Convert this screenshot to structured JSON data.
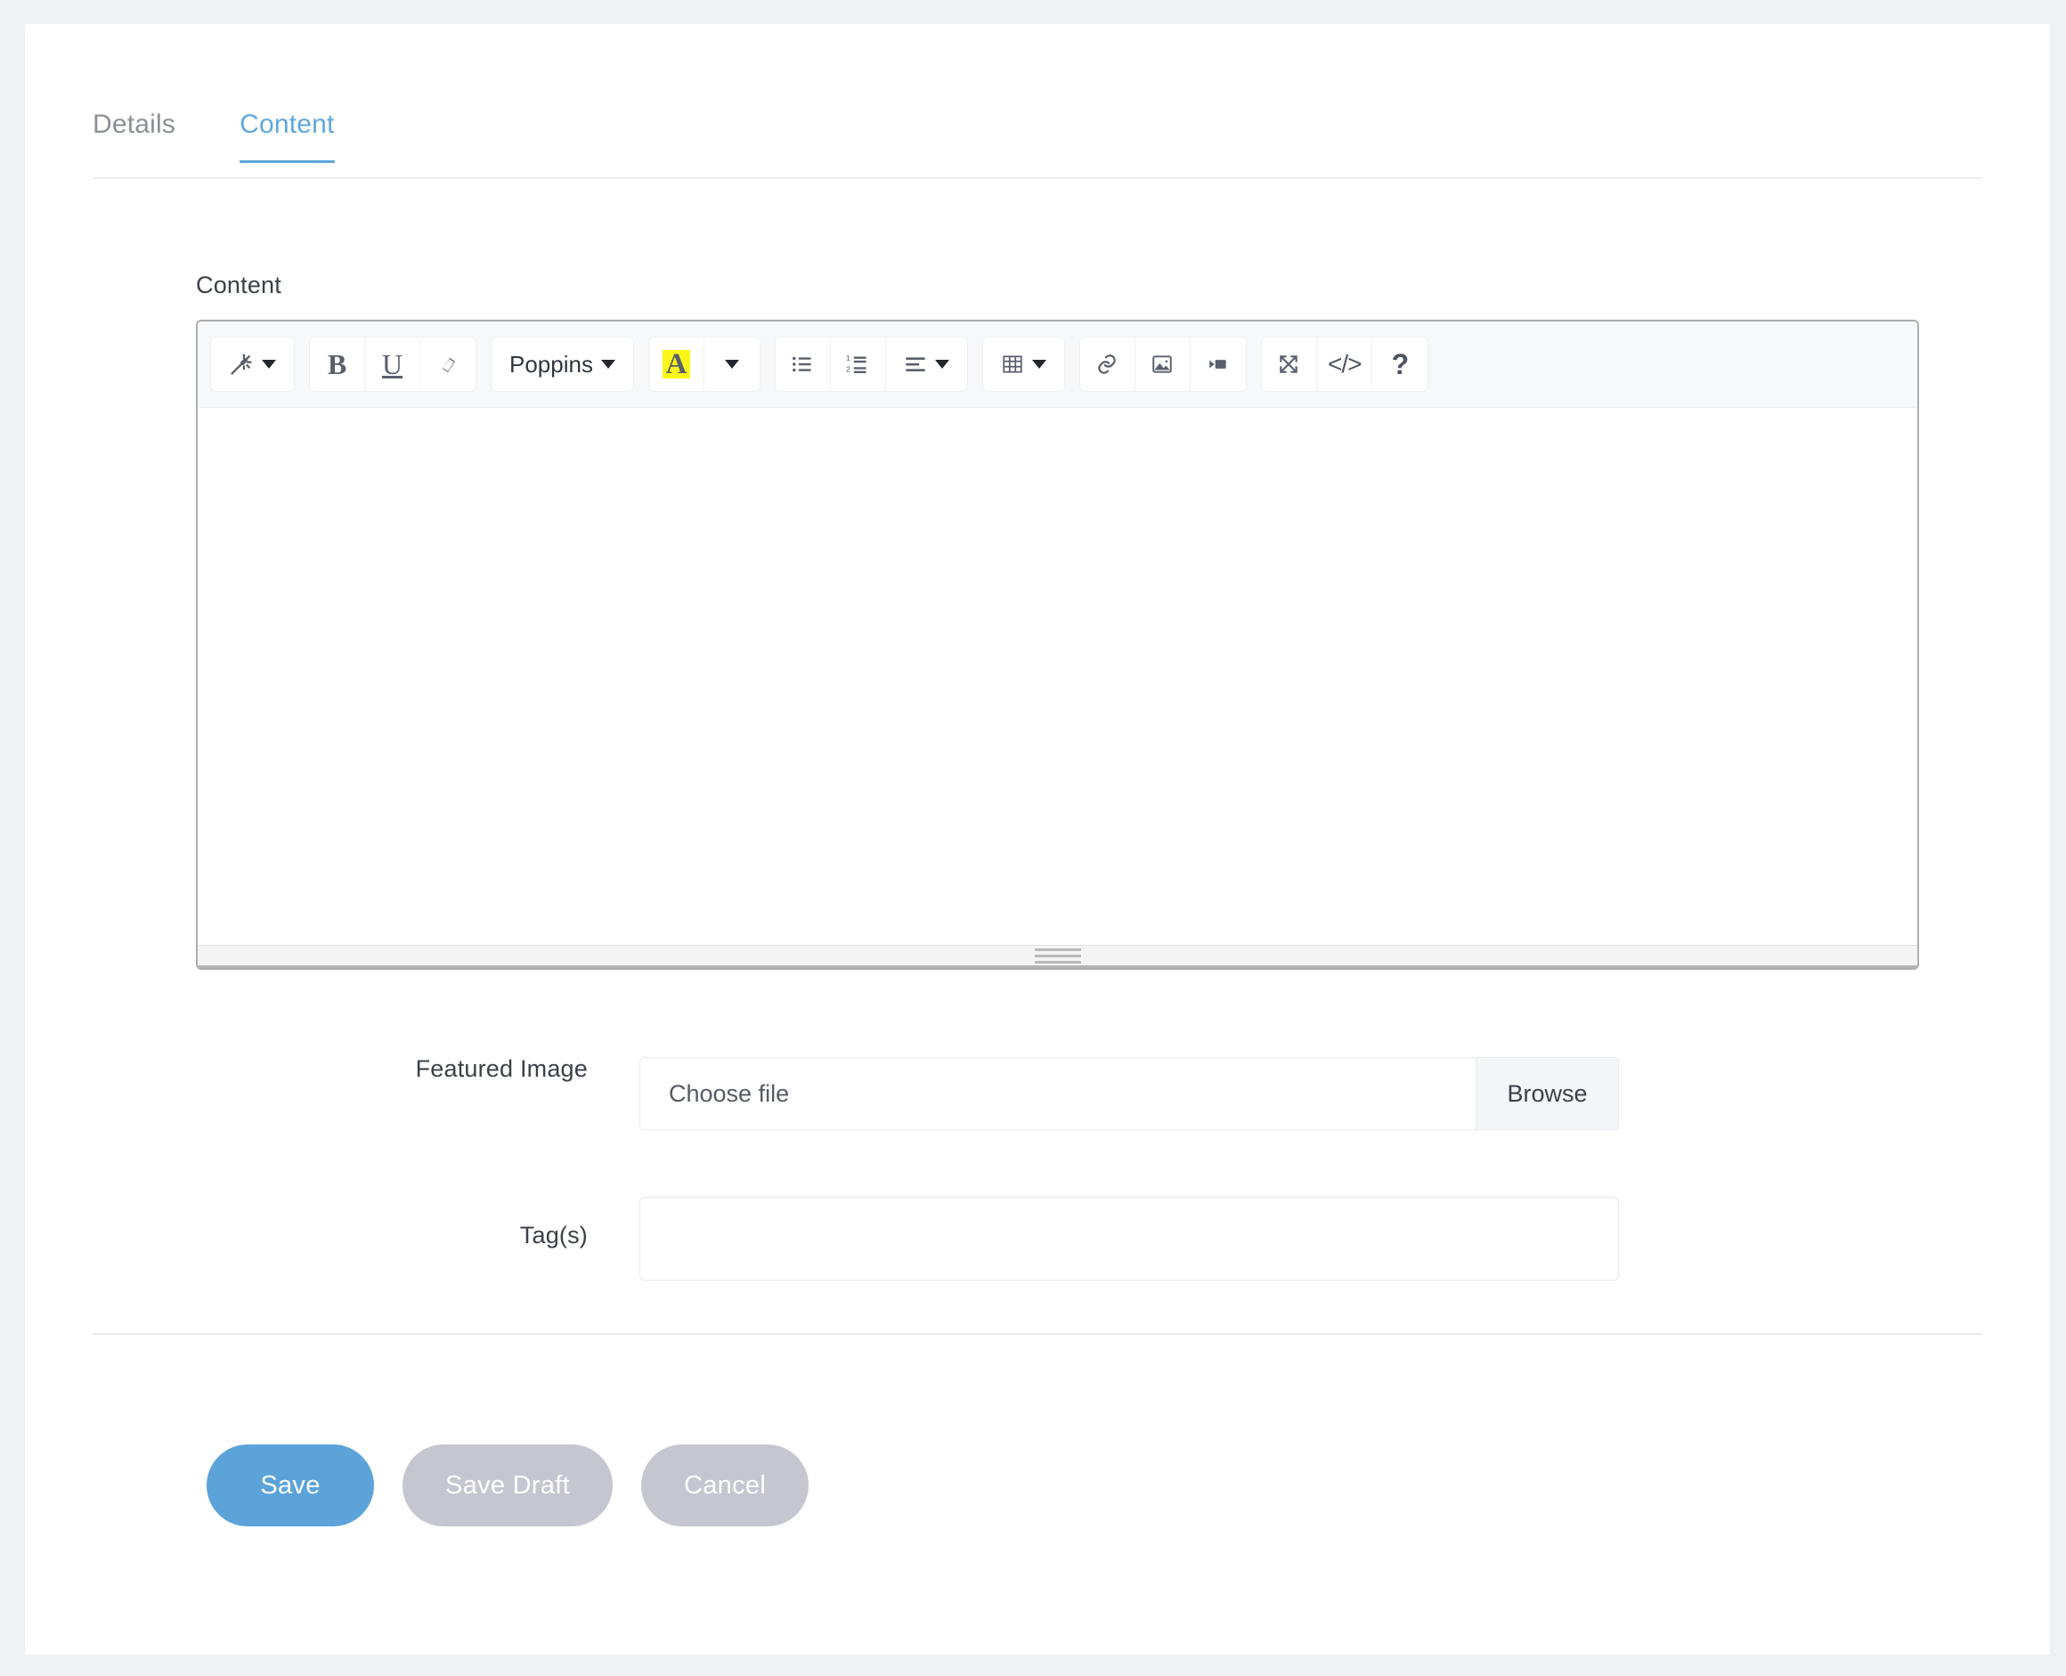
{
  "tabs": [
    {
      "label": "Details",
      "active": false
    },
    {
      "label": "Content",
      "active": true
    }
  ],
  "editor_section": {
    "label": "Content",
    "body_text": "",
    "toolbar": {
      "groups": [
        {
          "name": "magic",
          "buttons": [
            {
              "icon": "magic-wand-icon",
              "label": "",
              "has_caret": true
            }
          ]
        },
        {
          "name": "text-style",
          "buttons": [
            {
              "icon": "bold-icon",
              "label": "B",
              "has_caret": false
            },
            {
              "icon": "underline-icon",
              "label": "U",
              "has_caret": false
            },
            {
              "icon": "eraser-icon",
              "label": "",
              "has_caret": false
            }
          ]
        },
        {
          "name": "font-family",
          "buttons": [
            {
              "icon": "font-family-icon",
              "label": "Poppins",
              "has_caret": true
            }
          ]
        },
        {
          "name": "text-color",
          "buttons": [
            {
              "icon": "text-highlight-icon",
              "label": "A",
              "has_caret": false
            },
            {
              "icon": "color-picker-icon",
              "label": "",
              "has_caret": true
            }
          ]
        },
        {
          "name": "lists",
          "buttons": [
            {
              "icon": "unordered-list-icon",
              "label": "",
              "has_caret": false
            },
            {
              "icon": "ordered-list-icon",
              "label": "",
              "has_caret": false
            },
            {
              "icon": "align-icon",
              "label": "",
              "has_caret": true
            }
          ]
        },
        {
          "name": "table",
          "buttons": [
            {
              "icon": "table-icon",
              "label": "",
              "has_caret": true
            }
          ]
        },
        {
          "name": "insert",
          "buttons": [
            {
              "icon": "link-icon",
              "label": "",
              "has_caret": false
            },
            {
              "icon": "image-icon",
              "label": "",
              "has_caret": false
            },
            {
              "icon": "video-icon",
              "label": "",
              "has_caret": false
            }
          ]
        },
        {
          "name": "misc",
          "buttons": [
            {
              "icon": "fullscreen-icon",
              "label": "",
              "has_caret": false
            },
            {
              "icon": "code-view-icon",
              "label": "</>",
              "has_caret": false
            },
            {
              "icon": "help-icon",
              "label": "?",
              "has_caret": false
            }
          ]
        }
      ]
    },
    "resize_handle": "resize-grip"
  },
  "fields": {
    "featured_image": {
      "label": "Featured Image",
      "value": "",
      "placeholder": "Choose file",
      "browse_label": "Browse"
    },
    "tags": {
      "label": "Tag(s)",
      "value": "",
      "placeholder": ""
    }
  },
  "actions": {
    "save": "Save",
    "save_draft": "Save Draft",
    "cancel": "Cancel"
  },
  "colors": {
    "accent": "#5ba3d9",
    "muted_button": "#c5c6d0",
    "page_background": "#eef0f4",
    "card_background": "#ffffff",
    "highlight_yellow": "#fbf719",
    "tab_inactive": "#8b8f98"
  }
}
